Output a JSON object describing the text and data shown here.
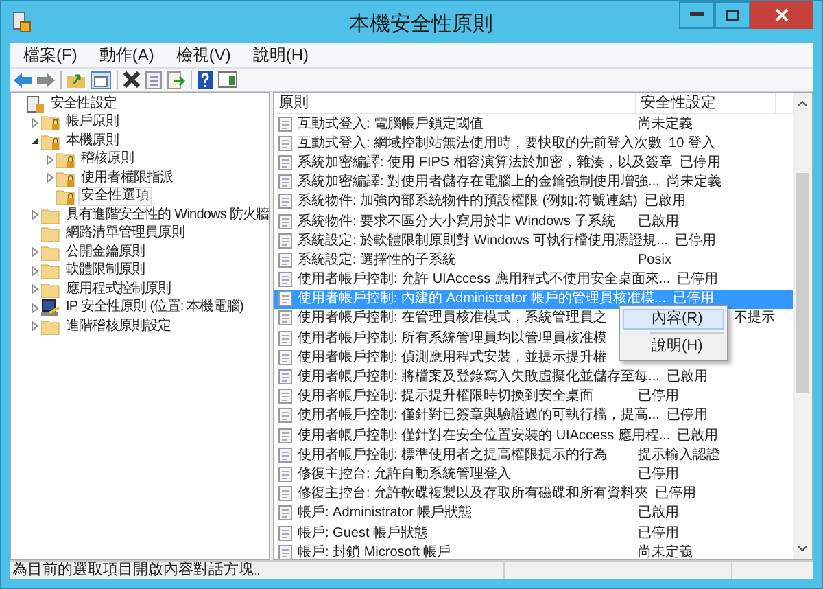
{
  "window": {
    "title": "本機安全性原則"
  },
  "menu": [
    "檔案(F)",
    "動作(A)",
    "檢視(V)",
    "說明(H)"
  ],
  "tree": [
    {
      "label": "安全性設定",
      "kind": "policy",
      "selected": false,
      "children": [
        {
          "label": "帳戶原則",
          "kind": "lockfolder",
          "expanded": false,
          "selected": false
        },
        {
          "label": "本機原則",
          "kind": "lockfolder",
          "expanded": true,
          "selected": false,
          "children": [
            {
              "label": "稽核原則",
              "kind": "lockfolder",
              "expanded": false,
              "selected": false
            },
            {
              "label": "使用者權限指派",
              "kind": "lockfolder",
              "expanded": false,
              "selected": false
            },
            {
              "label": "安全性選項",
              "kind": "lockfolder",
              "selected": true
            }
          ]
        },
        {
          "label": "具有進階安全性的 Windows 防火牆",
          "kind": "folder",
          "expanded": false,
          "selected": false
        },
        {
          "label": "網路清單管理員原則",
          "kind": "folder",
          "selected": false
        },
        {
          "label": "公開金鑰原則",
          "kind": "folder",
          "expanded": false,
          "selected": false
        },
        {
          "label": "軟體限制原則",
          "kind": "folder",
          "expanded": false,
          "selected": false
        },
        {
          "label": "應用程式控制原則",
          "kind": "folder",
          "expanded": false,
          "selected": false
        },
        {
          "label": "IP 安全性原則 (位置: 本機電腦)",
          "kind": "computer",
          "expanded": false,
          "selected": false
        },
        {
          "label": "進階稽核原則設定",
          "kind": "folder",
          "expanded": false,
          "selected": false
        }
      ]
    }
  ],
  "table": {
    "columns": [
      "原則",
      "安全性設定"
    ],
    "rows": [
      {
        "policy": "互動式登入: 電腦帳戶鎖定閾值",
        "setting": "尚未定義",
        "selected": false
      },
      {
        "policy": "互動式登入: 網域控制站無法使用時，要快取的先前登入次數",
        "setting": "10 登入",
        "selected": false
      },
      {
        "policy": "系統加密編譯: 使用 FIPS 相容演算法於加密，雜湊，以及簽章",
        "setting": "已停用",
        "selected": false
      },
      {
        "policy": "系統加密編譯: 對使用者儲存在電腦上的金鑰強制使用增強...",
        "setting": "尚未定義",
        "selected": false
      },
      {
        "policy": "系統物件: 加強內部系統物件的預設權限 (例如:符號連結)",
        "setting": "已啟用",
        "selected": false
      },
      {
        "policy": "系統物件: 要求不區分大小寫用於非 Windows 子系統",
        "setting": "已啟用",
        "selected": false
      },
      {
        "policy": "系統設定: 於軟體限制原則對 Windows 可執行檔使用憑證規...",
        "setting": "已停用",
        "selected": false
      },
      {
        "policy": "系統設定: 選擇性的子系統",
        "setting": "Posix",
        "selected": false
      },
      {
        "policy": "使用者帳戶控制: 允許 UIAccess 應用程式不使用安全桌面來...",
        "setting": "已停用",
        "selected": false
      },
      {
        "policy": "使用者帳戶控制: 內建的 Administrator 帳戶的管理員核准模...",
        "setting": "已停用",
        "selected": true
      },
      {
        "policy": "使用者帳戶控制: 在管理員核准模式，系統管理員之",
        "setting": "不提示",
        "selected": false,
        "covered": true
      },
      {
        "policy": "使用者帳戶控制: 所有系統管理員均以管理員核准模",
        "selected": false,
        "covered": true
      },
      {
        "policy": "使用者帳戶控制: 偵測應用程式安裝，並提示提升權",
        "selected": false,
        "covered": true
      },
      {
        "policy": "使用者帳戶控制: 將檔案及登錄寫入失敗虛擬化並儲存至每...",
        "setting": "已啟用",
        "selected": false
      },
      {
        "policy": "使用者帳戶控制: 提示提升權限時切換到安全桌面",
        "setting": "已停用",
        "selected": false
      },
      {
        "policy": "使用者帳戶控制: 僅針對已簽章與驗證過的可執行檔，提高...",
        "setting": "已停用",
        "selected": false
      },
      {
        "policy": "使用者帳戶控制: 僅針對在安全位置安裝的 UIAccess 應用程...",
        "setting": "已啟用",
        "selected": false
      },
      {
        "policy": "使用者帳戶控制: 標準使用者之提高權限提示的行為",
        "setting": "提示輸入認證",
        "selected": false
      },
      {
        "policy": "修復主控台: 允許自動系統管理登入",
        "setting": "已停用",
        "selected": false
      },
      {
        "policy": "修復主控台: 允許軟碟複製以及存取所有磁碟和所有資料夾",
        "setting": "已停用",
        "selected": false
      },
      {
        "policy": "帳戶: Administrator 帳戶狀態",
        "setting": "已啟用",
        "selected": false
      },
      {
        "policy": "帳戶: Guest 帳戶狀態",
        "setting": "已停用",
        "selected": false
      },
      {
        "policy": "帳戶: 封鎖 Microsoft 帳戶",
        "setting": "尚未定義",
        "selected": false
      }
    ]
  },
  "context_menu": [
    {
      "label": "內容(R)",
      "selected": true
    },
    {
      "label": "說明(H)",
      "selected": false
    }
  ],
  "status_bar": "為目前的選取項目開啟內容對話方塊。"
}
